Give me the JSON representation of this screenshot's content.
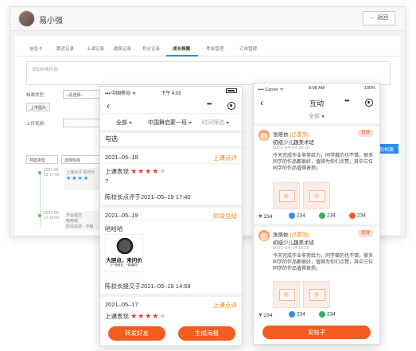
{
  "admin": {
    "user_name": "易小强",
    "back_label": "← 返回",
    "tabs": [
      "信息卡",
      "跟进记录",
      "上课记录",
      "缴费记录",
      "积分记录",
      "成长档案",
      "考级管理",
      "订单管理"
    ],
    "active_tab": "成长档案",
    "note_placeholder": "添加档案内容",
    "type_label": "档案类型:",
    "type_select": "--请选择--",
    "upload_label": "上传图片",
    "remind_label": "上传视频:",
    "add_button": "添加档案",
    "filter_type": "档案类型",
    "filter_select": "选择班级",
    "timeline": [
      {
        "date": "2021-05-19 17:40",
        "title": "上课点评",
        "author": "陈校长",
        "stars": "★★★★"
      },
      {
        "date": "2021-05-17 15:40",
        "title": "作业提交",
        "author": "哈哈哈",
        "extra": "阶段总结 · 平板"
      }
    ]
  },
  "phone1": {
    "status_left": "▪▪▪ 中国移动 ᯤ",
    "status_time": "下午 4:05",
    "filters": [
      "全部",
      "中国舞启蒙一班",
      "时间筛选"
    ],
    "check_label": "勾选",
    "entries": [
      {
        "date": "2021–05–19",
        "tag": "上课点评",
        "line1": "上课表现",
        "stars_on": "★★★★",
        "stars_off": "★",
        "line2": "?",
        "footer": "陈校长点评于2021–05–19 17:40"
      },
      {
        "date": "2021–05–19",
        "tag": "阶段总结",
        "line1": "哈哈哈",
        "meme_big": "大胆点，来问价",
        "meme_small": "万一我便宜，一锅端都行",
        "footer": "陈校长提交于2021–05–19 14:59"
      },
      {
        "date": "2021–05–17",
        "tag": "上课点评",
        "line1": "上课表现",
        "stars_on": "★★★★",
        "stars_off": "★"
      }
    ],
    "share_button": "转发好友",
    "poster_button": "生成海报"
  },
  "phone2": {
    "status_left": "•••• Carrier ᯤ",
    "status_time": "8:08 AM",
    "status_right": "100%",
    "title": "互动",
    "filter": "全部",
    "posts": [
      {
        "name": "张烙依",
        "pinned": "(已置顶)",
        "admin": "管理",
        "class": "初级少儿趣美术班",
        "time": "2021–04–04 16:26",
        "body": "今天完成作业非常给力，同学做的也不错，很多同学的作品都很好，值得为你们点赞，其中三位同学的作品值得表扬；",
        "likes": "234",
        "comments": "234",
        "shares": "234",
        "gifts": "234"
      },
      {
        "name": "张烙依",
        "pinned": "(已置顶)",
        "admin": "管理",
        "class": "初级少儿趣美术班",
        "time": "2021–04–04 16:26",
        "body": "今天完成作业非常给力，同学做的也不错，很多同学的作品都很好，值得为你们点赞，其中三位同学的作品值得表扬；",
        "likes": "234",
        "comments": "234",
        "shares": "234"
      }
    ],
    "post_button": "发帖子"
  }
}
